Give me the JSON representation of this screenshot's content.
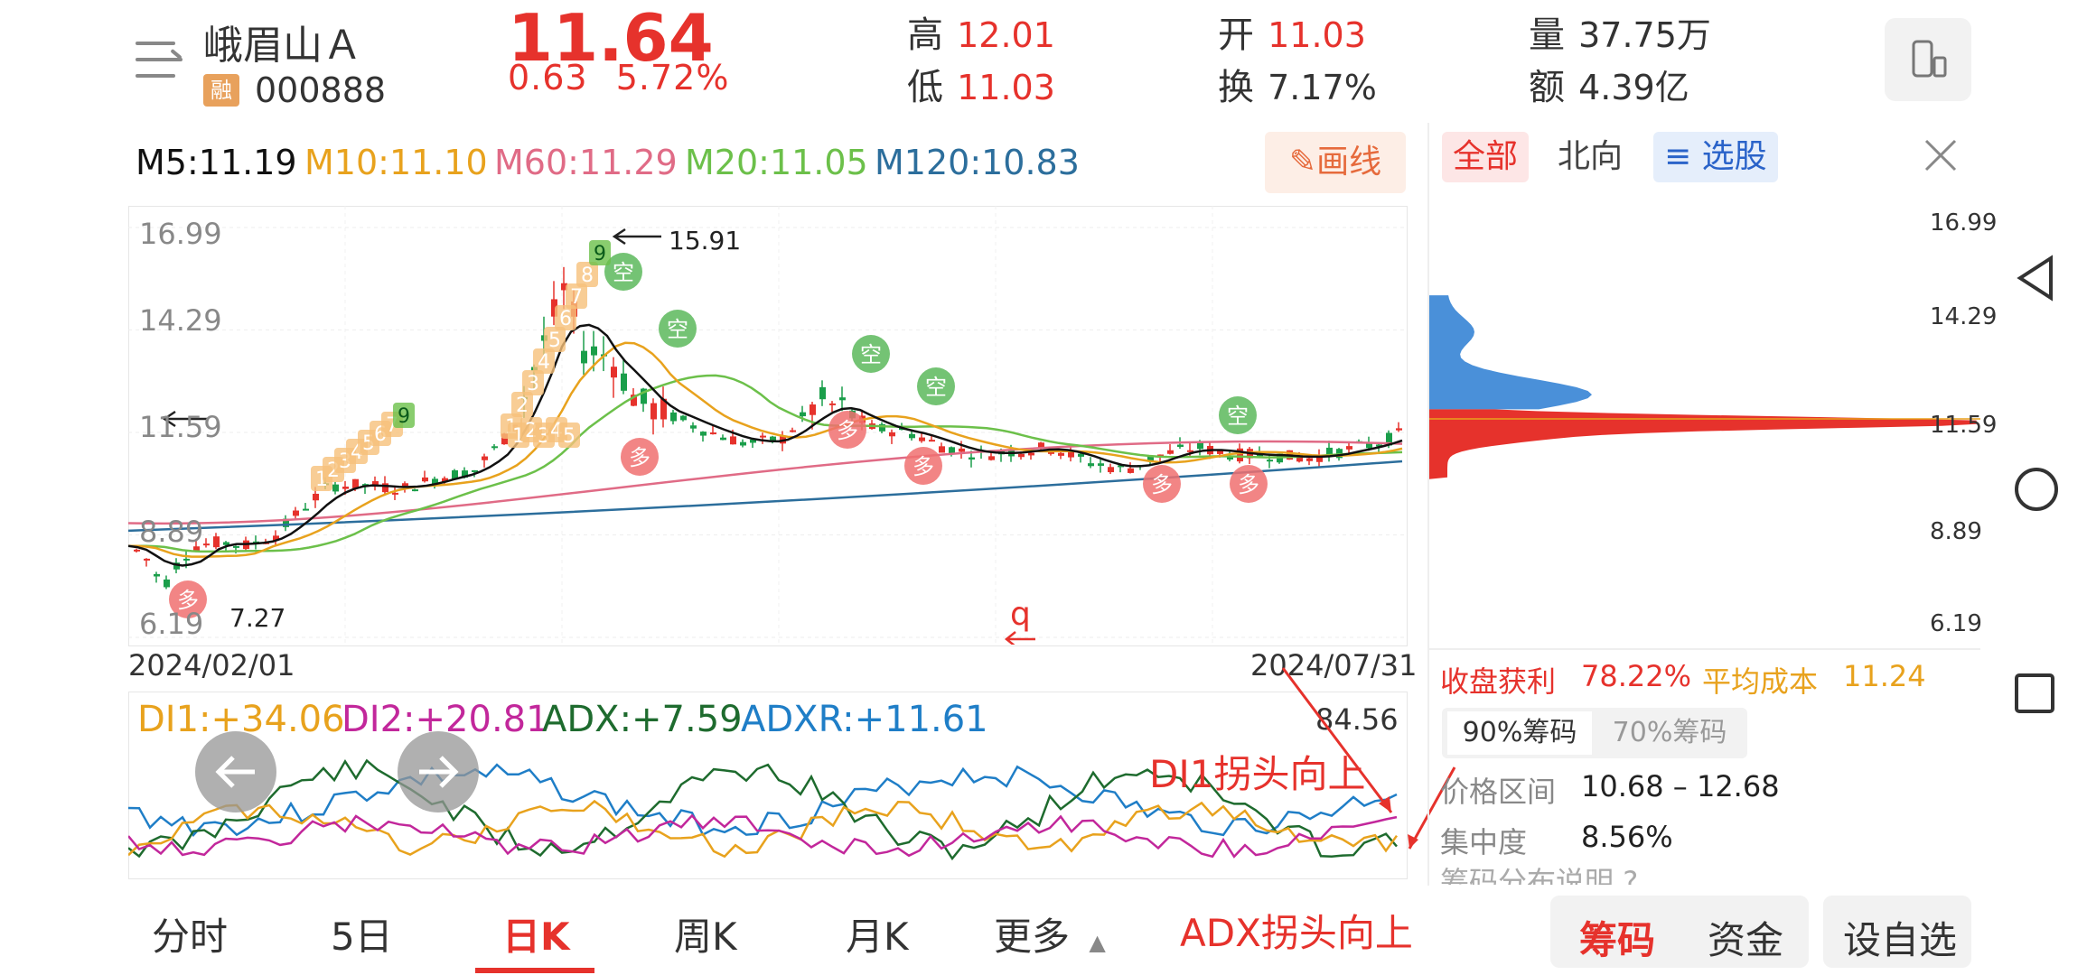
{
  "header": {
    "name": "峨眉山Ａ",
    "badge": "融",
    "code": "000888",
    "price": "11.64",
    "change": "0.63",
    "change_pct": "5.72%",
    "high_label": "高",
    "high": "12.01",
    "low_label": "低",
    "low": "11.03",
    "open_label": "开",
    "open": "11.03",
    "turnover_label": "换",
    "turnover": "7.17%",
    "volume_label": "量",
    "volume": "37.75万",
    "amount_label": "额",
    "amount": "4.39亿"
  },
  "ma": {
    "m5": "M5:11.19",
    "m10": "M10:11.10",
    "m60": "M60:11.29",
    "m20": "M20:11.05",
    "m120": "M120:10.83",
    "draw_label": "画线",
    "colors": {
      "m5": "#111111",
      "m10": "#e8a21d",
      "m60": "#e06b86",
      "m20": "#6cc04a",
      "m120": "#2c6e9c"
    }
  },
  "chart": {
    "y_ticks": [
      "16.99",
      "14.29",
      "11.59",
      "8.89",
      "6.19"
    ],
    "start_date": "2024/02/01",
    "end_date": "2024/07/31",
    "peak_label": "15.91",
    "trough_label": "7.27",
    "q_label": "q",
    "empty_label": "空",
    "long_label": "多",
    "seq_nine": "9",
    "seq_a": [
      "1",
      "2",
      "3",
      "4",
      "5",
      "6",
      "7",
      "9"
    ],
    "seq_b": [
      "1",
      "2",
      "3",
      "4",
      "5",
      "6",
      "7",
      "8"
    ],
    "colors": {
      "up": "#e6322c",
      "down": "#1a9e4a"
    }
  },
  "indicator": {
    "di1": "DI1:+34.06",
    "di2": "DI2:+20.81",
    "adx": "ADX:+7.59",
    "adxr": "ADXR:+11.61",
    "max": "84.56",
    "annotation_di1": "DI1拐头向上",
    "annotation_adx": "ADX拐头向上",
    "colors": {
      "di1": "#e8a21d",
      "di2": "#c2279b",
      "adx": "#1e6b2e",
      "adxr": "#1f7ec7"
    }
  },
  "right_panel": {
    "tabs": [
      "全部",
      "北向",
      "选股"
    ],
    "y_ticks": [
      "16.99",
      "14.29",
      "11.59",
      "8.89",
      "6.19"
    ],
    "profit_label": "收盘获利",
    "profit": "78.22%",
    "avg_cost_label": "平均成本",
    "avg_cost": "11.24",
    "chip_tabs": [
      "90%筹码",
      "70%筹码"
    ],
    "range_label": "价格区间",
    "range": "10.68 – 12.68",
    "concentration_label": "集中度",
    "concentration": "8.56%",
    "desc_label": "筹码分布说明"
  },
  "bottom_nav": {
    "tabs": [
      "分时",
      "5日",
      "日K",
      "周K",
      "月K",
      "更多"
    ],
    "chip_btn": "筹码",
    "fund_btn": "资金",
    "watch_btn": "设自选"
  }
}
